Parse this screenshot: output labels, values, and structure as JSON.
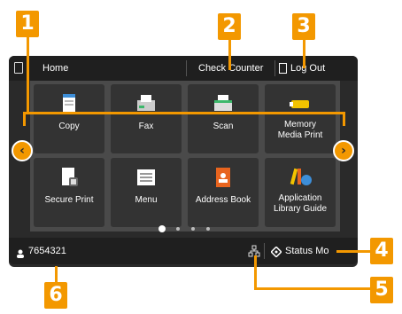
{
  "callouts": [
    "1",
    "2",
    "3",
    "4",
    "5",
    "6"
  ],
  "header": {
    "home_label": "Home",
    "check_counter_label": "Check Counter",
    "logout_label": "Log Out"
  },
  "tiles": [
    {
      "label": "Copy",
      "icon": "copy-icon"
    },
    {
      "label": "Fax",
      "icon": "fax-icon"
    },
    {
      "label": "Scan",
      "icon": "scan-icon"
    },
    {
      "label": "Memory\nMedia Print",
      "icon": "memory-media-icon"
    },
    {
      "label": "Secure Print",
      "icon": "secure-print-icon"
    },
    {
      "label": "Menu",
      "icon": "menu-icon"
    },
    {
      "label": "Address Book",
      "icon": "address-book-icon"
    },
    {
      "label": "Application\nLibrary Guide",
      "icon": "application-library-icon"
    }
  ],
  "nav": {
    "prev": "‹",
    "next": "›"
  },
  "footer": {
    "user_id": "7654321",
    "status_label": "Status Mo"
  },
  "colors": {
    "accent": "#f39800",
    "panel": "#2a2a2a",
    "bar": "#1f1f1f"
  }
}
